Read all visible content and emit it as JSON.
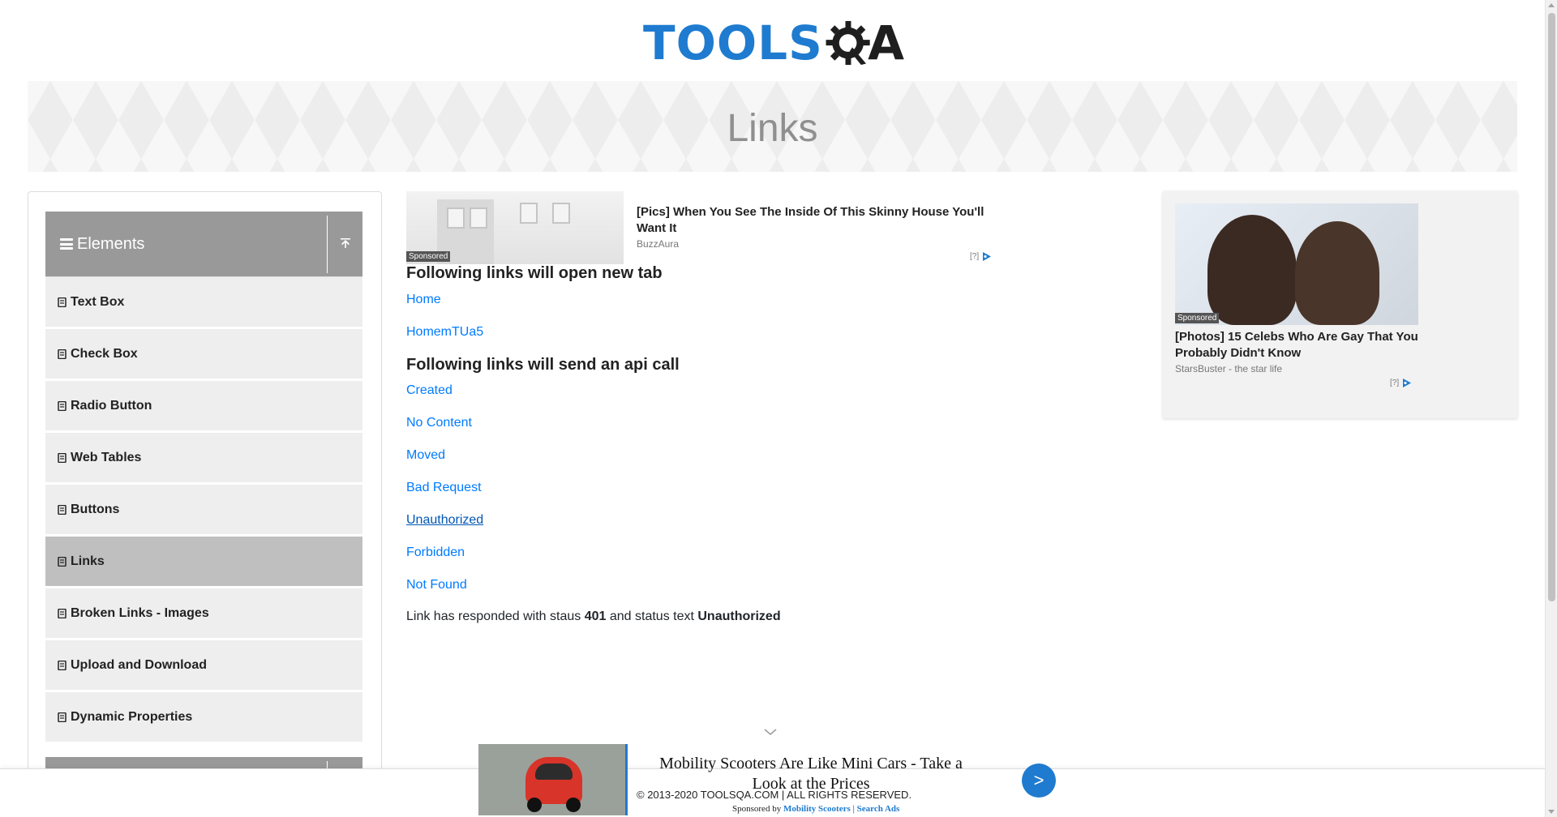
{
  "logo": {
    "text": "TOOLS",
    "suffix": "A"
  },
  "banner": {
    "title": "Links"
  },
  "sidebar": {
    "group_title": "Elements",
    "items": [
      {
        "label": "Text Box"
      },
      {
        "label": "Check Box"
      },
      {
        "label": "Radio Button"
      },
      {
        "label": "Web Tables"
      },
      {
        "label": "Buttons"
      },
      {
        "label": "Links"
      },
      {
        "label": "Broken Links - Images"
      },
      {
        "label": "Upload and Download"
      },
      {
        "label": "Dynamic Properties"
      }
    ],
    "active_item": "Links"
  },
  "ads": {
    "top": {
      "title": "[Pics] When You See The Inside Of This Skinny House You'll Want It",
      "source": "BuzzAura",
      "sponsored": "Sponsored",
      "help": "[?]"
    },
    "right": {
      "title": "[Photos] 15 Celebs Who Are Gay That You Probably Didn't Know",
      "source": "StarsBuster - the star life",
      "sponsored": "Sponsored",
      "help": "[?]"
    },
    "bottom": {
      "title": "Mobility Scooters Are Like Mini Cars - Take a Look at the Prices",
      "sponsor_prefix": "Sponsored by",
      "sponsor_link": "Mobility Scooters | Search Ads",
      "go": ">"
    }
  },
  "main": {
    "new_tab_heading": "Following links will open new tab",
    "new_tab_links": [
      "Home",
      "HomemTUa5"
    ],
    "api_heading": "Following links will send an api call",
    "api_links": [
      "Created",
      "No Content",
      "Moved",
      "Bad Request",
      "Unauthorized",
      "Forbidden",
      "Not Found"
    ],
    "response": {
      "prefix": "Link has responded with staus",
      "status_code": "401",
      "middle": "and status text",
      "status_text": "Unauthorized"
    }
  },
  "footer": {
    "text": "© 2013-2020 TOOLSQA.COM | ALL RIGHTS RESERVED."
  },
  "colors": {
    "link": "#007bff",
    "brand": "#1f7bcf",
    "menu_bg": "#eeeeee",
    "menu_active": "#bfbfbf",
    "group_header": "#999999"
  }
}
